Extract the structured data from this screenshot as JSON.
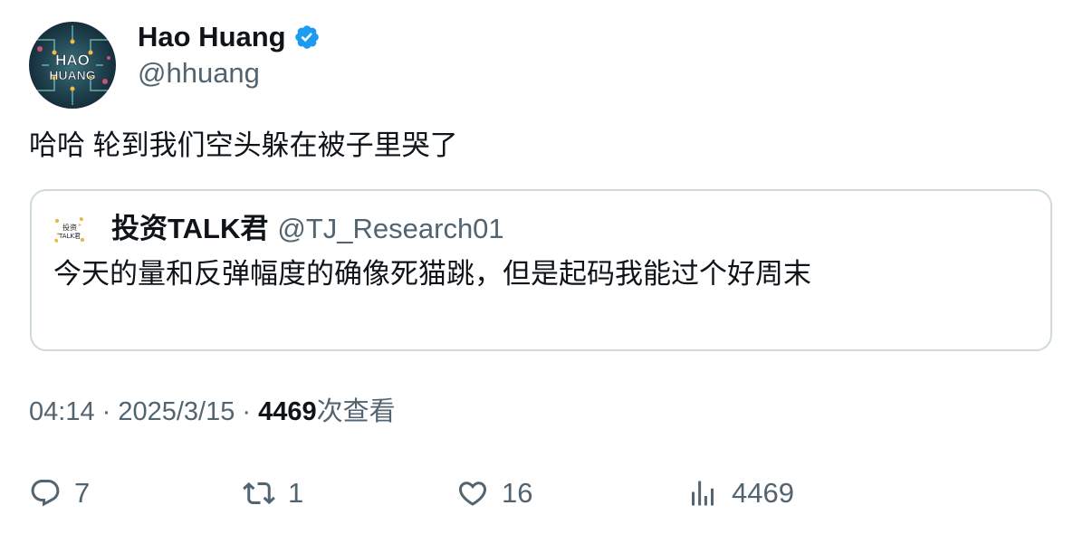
{
  "author": {
    "name": "Hao Huang",
    "handle": "@hhuang",
    "avatar_text_line1": "HAO",
    "avatar_text_line2": "HUANG"
  },
  "tweet": {
    "text": "哈哈 轮到我们空头躲在被子里哭了"
  },
  "quoted": {
    "name": "投资TALK君",
    "handle": "@TJ_Research01",
    "text": "今天的量和反弹幅度的确像死猫跳，但是起码我能过个好周末",
    "avatar_text_line1": "投资",
    "avatar_text_line2": "TALK君"
  },
  "meta": {
    "time": "04:14",
    "separator": " · ",
    "date": "2025/3/15",
    "views_count": "4469",
    "views_label": "次查看"
  },
  "actions": {
    "replies": "7",
    "retweets": "1",
    "likes": "16",
    "views": "4469"
  },
  "colors": {
    "verified": "#1d9bf0",
    "secondary_text": "#536471",
    "primary_text": "#0f1419",
    "border": "#cfd9de"
  },
  "icons": {
    "verified": "verified-badge-icon",
    "reply": "reply-icon",
    "retweet": "retweet-icon",
    "like": "heart-icon",
    "views": "analytics-icon"
  }
}
